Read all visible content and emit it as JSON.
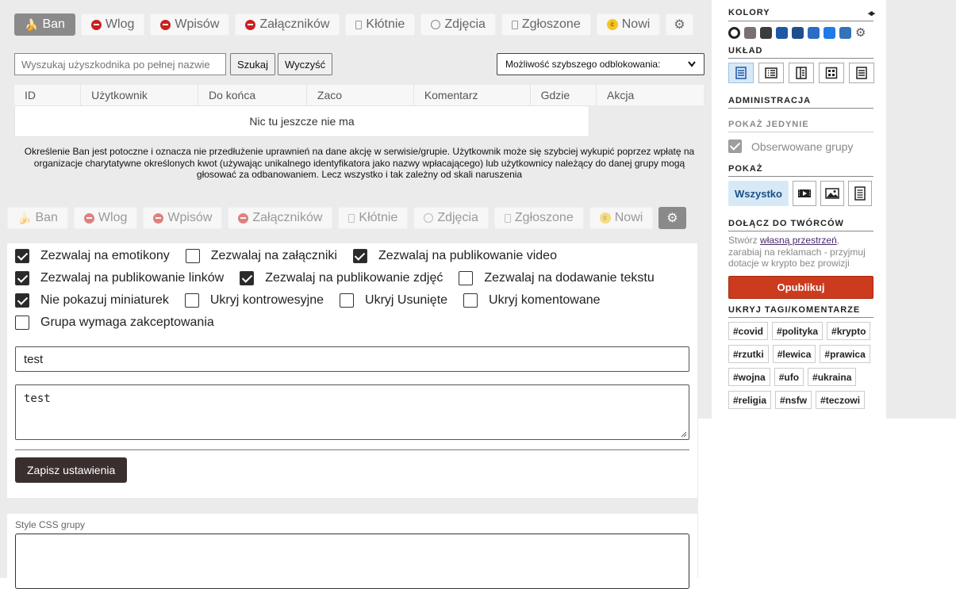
{
  "tabs_top": [
    {
      "label": "Ban",
      "icon": "banana-icon",
      "active": true
    },
    {
      "label": "Wlog",
      "icon": "no-entry-icon"
    },
    {
      "label": "Wpisów",
      "icon": "no-entry-icon"
    },
    {
      "label": "Załączników",
      "icon": "no-entry-icon"
    },
    {
      "label": "Kłótnie",
      "icon": "rect-icon"
    },
    {
      "label": "Zdjęcia",
      "icon": "face-icon"
    },
    {
      "label": "Zgłoszone",
      "icon": "rect-icon"
    },
    {
      "label": "Nowi",
      "icon": "gold-coin-icon"
    }
  ],
  "tabs_bottom": [
    {
      "label": "Ban",
      "icon": "banana-icon"
    },
    {
      "label": "Wlog",
      "icon": "no-entry-icon"
    },
    {
      "label": "Wpisów",
      "icon": "no-entry-icon"
    },
    {
      "label": "Załączników",
      "icon": "no-entry-icon"
    },
    {
      "label": "Kłótnie",
      "icon": "rect-icon"
    },
    {
      "label": "Zdjęcia",
      "icon": "face-icon"
    },
    {
      "label": "Zgłoszone",
      "icon": "rect-icon"
    },
    {
      "label": "Nowi",
      "icon": "gold-coin-icon"
    }
  ],
  "gear_glyph": "⚙",
  "search": {
    "placeholder": "Wyszukaj użyszkodnika po pełnej nazwie",
    "search_label": "Szukaj",
    "clear_label": "Wyczyść",
    "select_value": "Możliwość szybszego odblokowania:"
  },
  "table": {
    "headers": [
      "ID",
      "Użytkownik",
      "Do końca",
      "Zaco",
      "Komentarz",
      "Gdzie",
      "Akcja"
    ],
    "empty": "Nic tu jeszcze nie ma"
  },
  "note": "Określenie Ban jest potoczne i oznacza nie przedłużenie uprawnień na dane akcję w serwisie/grupie. Użytkownik może się szybciej wykupić poprzez wpłatę na organizacje charytatywne określonych kwot (używając unikalnego identyfikatora jako nazwy wpłacającego) lub użytkownicy należący do danej grupy mogą głosować za odbanowaniem. Lecz wszystko i tak zależny od skali naruszenia",
  "settings": {
    "rows": [
      [
        {
          "label": "Zezwalaj na emotikony",
          "checked": true
        },
        {
          "label": "Zezwalaj na załączniki",
          "checked": false
        },
        {
          "label": "Zezwalaj na publikowanie video",
          "checked": true
        }
      ],
      [
        {
          "label": "Zezwalaj na publikowanie linków",
          "checked": true
        },
        {
          "label": "Zezwalaj na publikowanie zdjęć",
          "checked": true
        },
        {
          "label": "Zezwalaj na dodawanie tekstu",
          "checked": false
        }
      ],
      [
        {
          "label": "Nie pokazuj miniaturek",
          "checked": true
        },
        {
          "label": "Ukryj kontrowesyjne",
          "checked": false
        },
        {
          "label": "Ukryj Usunięte",
          "checked": false
        },
        {
          "label": "Ukryj komentowane",
          "checked": false
        }
      ],
      [
        {
          "label": "Grupa wymaga zakceptowania",
          "checked": false
        }
      ]
    ],
    "input_value": "test",
    "textarea_value": "test",
    "save_label": "Zapisz ustawienia",
    "css_label": "Style CSS grupy"
  },
  "sidebar": {
    "colors_title": "KOLORY",
    "colors_arrows": "◂▸",
    "swatches": [
      "#ffffff",
      "#7a7070",
      "#3c3c3c",
      "#1f56a5",
      "#1f4e8c",
      "#2d6cc4",
      "#1e7be8",
      "#3572b8"
    ],
    "layout_title": "UKŁAD",
    "admin_title": "ADMINISTRACJA",
    "show_only_title": "POKAŻ JEDYNIE",
    "observed_label": "Obserwowane grupy",
    "show_title": "POKAŻ",
    "show_all_label": "Wszystko",
    "join_title": "DOŁĄCZ DO TWÓRCÓW",
    "creator_prefix": "Stwórz",
    "creator_link": "własną przestrzeń",
    "creator_suffix": ", zarabiaj na reklamach - przyjmuj dotacje w krypto bez prowizji",
    "publish_label": "Opublikuj",
    "hide_tags_title": "UKRYJ TAGI/KOMENTARZE",
    "tags": [
      "#covid",
      "#polityka",
      "#krypto",
      "#rzutki",
      "#lewica",
      "#prawica",
      "#wojna",
      "#ufo",
      "#ukraina",
      "#religia",
      "#nsfw",
      "#teczowi"
    ]
  }
}
